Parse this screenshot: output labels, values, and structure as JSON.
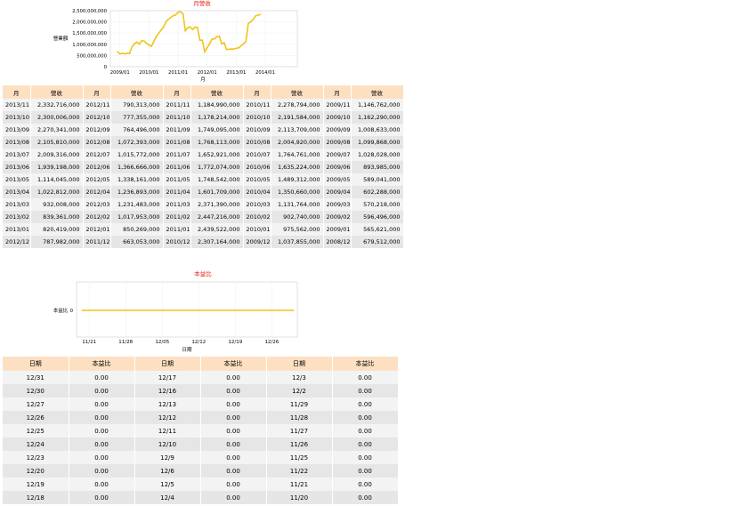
{
  "charts": [
    {
      "title": "月營收",
      "ylabel": "營業額",
      "xlabel": "月",
      "yticks": [
        "2,500,000,000",
        "2,000,000,000",
        "1,500,000,000",
        "1,000,000,000",
        "500,000,000",
        "0"
      ],
      "xticks": [
        "2009/01",
        "2010/01",
        "2011/01",
        "2012/01",
        "2013/01",
        "2014/01"
      ]
    },
    {
      "title": "本益比",
      "ylabel": "本益比",
      "xlabel": "日期",
      "yticks": [
        "0"
      ],
      "xticks": [
        "11/21",
        "11/28",
        "12/05",
        "12/12",
        "12/19",
        "12/26"
      ]
    }
  ],
  "chart_data": [
    {
      "type": "line",
      "title": "月營收",
      "xlabel": "月",
      "ylabel": "營業額",
      "ylim": [
        0,
        2500000000
      ],
      "color": "#f0c419",
      "x": [
        "2008/12",
        "2009/01",
        "2009/02",
        "2009/03",
        "2009/04",
        "2009/05",
        "2009/06",
        "2009/07",
        "2009/08",
        "2009/09",
        "2009/10",
        "2009/11",
        "2009/12",
        "2010/01",
        "2010/02",
        "2010/03",
        "2010/04",
        "2010/05",
        "2010/06",
        "2010/07",
        "2010/08",
        "2010/09",
        "2010/10",
        "2010/11",
        "2010/12",
        "2011/01",
        "2011/02",
        "2011/03",
        "2011/04",
        "2011/05",
        "2011/06",
        "2011/07",
        "2011/08",
        "2011/09",
        "2011/10",
        "2011/11",
        "2011/12",
        "2012/01",
        "2012/02",
        "2012/03",
        "2012/04",
        "2012/05",
        "2012/06",
        "2012/07",
        "2012/08",
        "2012/09",
        "2012/10",
        "2012/11",
        "2012/12",
        "2013/01",
        "2013/02",
        "2013/03",
        "2013/04",
        "2013/05",
        "2013/06",
        "2013/07",
        "2013/08",
        "2013/09",
        "2013/10",
        "2013/11"
      ],
      "values": [
        679512000,
        565621000,
        596496000,
        570218000,
        602288000,
        589041000,
        893985000,
        1028028000,
        1099868000,
        1008633000,
        1162290000,
        1146762000,
        1037855000,
        975562000,
        902740000,
        1131764000,
        1350660000,
        1489312000,
        1635224000,
        1764761000,
        2004920000,
        2113709000,
        2191584000,
        2278794000,
        2307164000,
        2439522000,
        2447216000,
        2371390000,
        1601709000,
        1748542000,
        1772074000,
        1652921000,
        1768113000,
        1749095000,
        1178214000,
        1184990000,
        663053000,
        850269000,
        1017953000,
        1231483000,
        1236893000,
        1338161000,
        1366666000,
        1015772000,
        1072393000,
        764496000,
        777355000,
        790313000,
        787982000,
        820419000,
        839361000,
        932008000,
        1022812000,
        1114045000,
        1939198000,
        2009316000,
        2105810000,
        2270341000,
        2300006000,
        2332716000
      ]
    },
    {
      "type": "line",
      "title": "本益比",
      "xlabel": "日期",
      "ylabel": "本益比",
      "color": "#f0c419",
      "x": [
        "11/20",
        "11/21",
        "11/22",
        "11/25",
        "11/26",
        "11/27",
        "11/28",
        "11/29",
        "12/2",
        "12/3",
        "12/4",
        "12/5",
        "12/6",
        "12/9",
        "12/10",
        "12/11",
        "12/12",
        "12/13",
        "12/16",
        "12/17",
        "12/18",
        "12/19",
        "12/20",
        "12/23",
        "12/24",
        "12/25",
        "12/26",
        "12/27",
        "12/30",
        "12/31"
      ],
      "values": [
        0,
        0,
        0,
        0,
        0,
        0,
        0,
        0,
        0,
        0,
        0,
        0,
        0,
        0,
        0,
        0,
        0,
        0,
        0,
        0,
        0,
        0,
        0,
        0,
        0,
        0,
        0,
        0,
        0,
        0
      ]
    }
  ],
  "rev_table": {
    "headers": [
      "月",
      "營收",
      "月",
      "營收",
      "月",
      "營收",
      "月",
      "營收",
      "月",
      "營收"
    ],
    "rows": [
      [
        "2013/11",
        "2,332,716,000",
        "2012/11",
        "790,313,000",
        "2011/11",
        "1,184,990,000",
        "2010/11",
        "2,278,794,000",
        "2009/11",
        "1,146,762,000"
      ],
      [
        "2013/10",
        "2,300,006,000",
        "2012/10",
        "777,355,000",
        "2011/10",
        "1,178,214,000",
        "2010/10",
        "2,191,584,000",
        "2009/10",
        "1,162,290,000"
      ],
      [
        "2013/09",
        "2,270,341,000",
        "2012/09",
        "764,496,000",
        "2011/09",
        "1,749,095,000",
        "2010/09",
        "2,113,709,000",
        "2009/09",
        "1,008,633,000"
      ],
      [
        "2013/08",
        "2,105,810,000",
        "2012/08",
        "1,072,393,000",
        "2011/08",
        "1,768,113,000",
        "2010/08",
        "2,004,920,000",
        "2009/08",
        "1,099,868,000"
      ],
      [
        "2013/07",
        "2,009,316,000",
        "2012/07",
        "1,015,772,000",
        "2011/07",
        "1,652,921,000",
        "2010/07",
        "1,764,761,000",
        "2009/07",
        "1,028,028,000"
      ],
      [
        "2013/06",
        "1,939,198,000",
        "2012/06",
        "1,366,666,000",
        "2011/06",
        "1,772,074,000",
        "2010/06",
        "1,635,224,000",
        "2009/06",
        "893,985,000"
      ],
      [
        "2013/05",
        "1,114,045,000",
        "2012/05",
        "1,338,161,000",
        "2011/05",
        "1,748,542,000",
        "2010/05",
        "1,489,312,000",
        "2009/05",
        "589,041,000"
      ],
      [
        "2013/04",
        "1,022,812,000",
        "2012/04",
        "1,236,893,000",
        "2011/04",
        "1,601,709,000",
        "2010/04",
        "1,350,660,000",
        "2009/04",
        "602,288,000"
      ],
      [
        "2013/03",
        "932,008,000",
        "2012/03",
        "1,231,483,000",
        "2011/03",
        "2,371,390,000",
        "2010/03",
        "1,131,764,000",
        "2009/03",
        "570,218,000"
      ],
      [
        "2013/02",
        "839,361,000",
        "2012/02",
        "1,017,953,000",
        "2011/02",
        "2,447,216,000",
        "2010/02",
        "902,740,000",
        "2009/02",
        "596,496,000"
      ],
      [
        "2013/01",
        "820,419,000",
        "2012/01",
        "850,269,000",
        "2011/01",
        "2,439,522,000",
        "2010/01",
        "975,562,000",
        "2009/01",
        "565,621,000"
      ],
      [
        "2012/12",
        "787,982,000",
        "2011/12",
        "663,053,000",
        "2010/12",
        "2,307,164,000",
        "2009/12",
        "1,037,855,000",
        "2008/12",
        "679,512,000"
      ]
    ]
  },
  "ratio_table": {
    "headers": [
      "日期",
      "本益比",
      "日期",
      "本益比",
      "日期",
      "本益比"
    ],
    "rows": [
      [
        "12/31",
        "0.00",
        "12/17",
        "0.00",
        "12/3",
        "0.00"
      ],
      [
        "12/30",
        "0.00",
        "12/16",
        "0.00",
        "12/2",
        "0.00"
      ],
      [
        "12/27",
        "0.00",
        "12/13",
        "0.00",
        "11/29",
        "0.00"
      ],
      [
        "12/26",
        "0.00",
        "12/12",
        "0.00",
        "11/28",
        "0.00"
      ],
      [
        "12/25",
        "0.00",
        "12/11",
        "0.00",
        "11/27",
        "0.00"
      ],
      [
        "12/24",
        "0.00",
        "12/10",
        "0.00",
        "11/26",
        "0.00"
      ],
      [
        "12/23",
        "0.00",
        "12/9",
        "0.00",
        "11/25",
        "0.00"
      ],
      [
        "12/20",
        "0.00",
        "12/6",
        "0.00",
        "11/22",
        "0.00"
      ],
      [
        "12/19",
        "0.00",
        "12/5",
        "0.00",
        "11/21",
        "0.00"
      ],
      [
        "12/18",
        "0.00",
        "12/4",
        "0.00",
        "11/20",
        "0.00"
      ]
    ]
  }
}
